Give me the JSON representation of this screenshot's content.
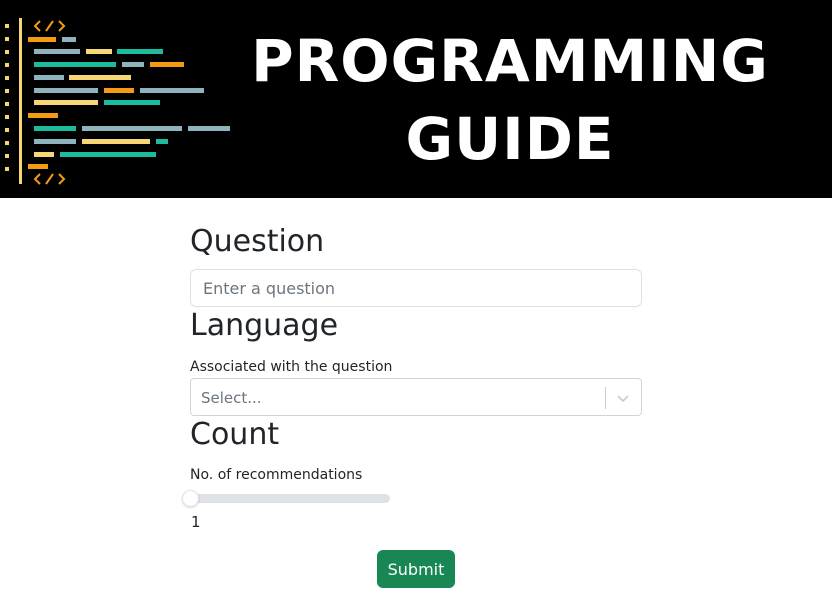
{
  "banner": {
    "title_line1": "PROGRAMMING",
    "title_line2": "GUIDE",
    "logo_icon": "code-brackets-icon",
    "colors": {
      "background": "#000000",
      "orange": "#f39c12",
      "yellow": "#f7d774",
      "teal": "#1abc9c",
      "gray_blue": "#8fb3bc"
    }
  },
  "form": {
    "question": {
      "heading": "Question",
      "placeholder": "Enter a question",
      "value": ""
    },
    "language": {
      "heading": "Language",
      "sublabel": "Associated with the question",
      "placeholder": "Select...",
      "chevron_icon": "chevron-down-icon"
    },
    "count": {
      "heading": "Count",
      "sublabel": "No. of recommendations",
      "value": "1",
      "fraction": 0
    },
    "submit_label": "Submit",
    "accent_color": "#198754"
  }
}
